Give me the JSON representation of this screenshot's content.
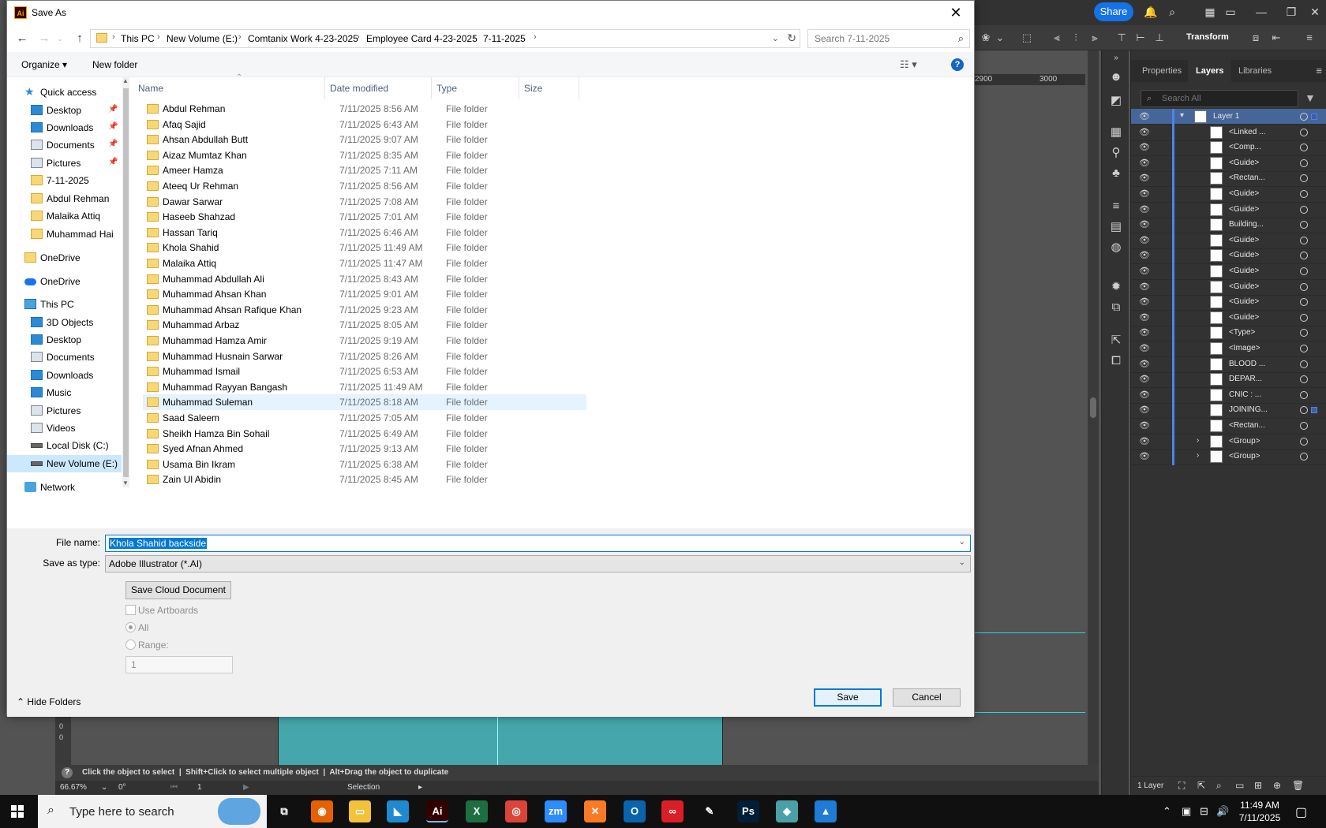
{
  "dialog": {
    "title": "Save As",
    "close_glyph": "✕",
    "breadcrumbs": [
      "This PC",
      "New Volume (E:)",
      "Comtanix Work 4-23-2025",
      "Employee Card 4-23-2025",
      "7-11-2025"
    ],
    "search_placeholder": "Search 7-11-2025",
    "toolbar": {
      "organize": "Organize ▾",
      "new_folder": "New folder",
      "help": "?"
    },
    "nav_pane": [
      {
        "label": "Quick access",
        "icon": "star-icon",
        "pinned": false
      },
      {
        "label": "Desktop",
        "icon": "desktop-icon",
        "pinned": true
      },
      {
        "label": "Downloads",
        "icon": "download-icon",
        "pinned": true
      },
      {
        "label": "Documents",
        "icon": "documents-icon",
        "pinned": true
      },
      {
        "label": "Pictures",
        "icon": "pictures-icon",
        "pinned": true
      },
      {
        "label": "7-11-2025",
        "icon": "folder-icon",
        "pinned": false
      },
      {
        "label": "Abdul Rehman",
        "icon": "folder-icon",
        "pinned": false
      },
      {
        "label": "Malaika Attiq",
        "icon": "folder-icon",
        "pinned": false
      },
      {
        "label": "Muhammad Hai",
        "icon": "folder-icon",
        "pinned": false
      },
      {
        "label": "OneDrive",
        "icon": "folder-icon",
        "pinned": false
      },
      {
        "label": "OneDrive",
        "icon": "cloud-icon",
        "pinned": false
      },
      {
        "label": "This PC",
        "icon": "pc-icon",
        "pinned": false
      },
      {
        "label": "3D Objects",
        "icon": "objects-3d-icon",
        "pinned": false
      },
      {
        "label": "Desktop",
        "icon": "desktop-icon",
        "pinned": false
      },
      {
        "label": "Documents",
        "icon": "documents-icon",
        "pinned": false
      },
      {
        "label": "Downloads",
        "icon": "download-icon",
        "pinned": false
      },
      {
        "label": "Music",
        "icon": "music-icon",
        "pinned": false
      },
      {
        "label": "Pictures",
        "icon": "pictures-icon",
        "pinned": false
      },
      {
        "label": "Videos",
        "icon": "videos-icon",
        "pinned": false
      },
      {
        "label": "Local Disk (C:)",
        "icon": "disk-icon",
        "pinned": false
      },
      {
        "label": "New Volume (E:)",
        "icon": "disk-icon",
        "pinned": false,
        "selected": true
      },
      {
        "label": "Network",
        "icon": "network-icon",
        "pinned": false
      }
    ],
    "columns": [
      "Name",
      "Date modified",
      "Type",
      "Size"
    ],
    "files": [
      {
        "name": "Abdul Rehman",
        "date": "7/11/2025 8:56 AM",
        "type": "File folder"
      },
      {
        "name": "Afaq Sajid",
        "date": "7/11/2025 6:43 AM",
        "type": "File folder"
      },
      {
        "name": "Ahsan Abdullah Butt",
        "date": "7/11/2025 9:07 AM",
        "type": "File folder"
      },
      {
        "name": "Aizaz Mumtaz Khan",
        "date": "7/11/2025 8:35 AM",
        "type": "File folder"
      },
      {
        "name": "Ameer Hamza",
        "date": "7/11/2025 7:11 AM",
        "type": "File folder"
      },
      {
        "name": "Ateeq Ur Rehman",
        "date": "7/11/2025 8:56 AM",
        "type": "File folder"
      },
      {
        "name": "Dawar Sarwar",
        "date": "7/11/2025 7:08 AM",
        "type": "File folder"
      },
      {
        "name": "Haseeb Shahzad",
        "date": "7/11/2025 7:01 AM",
        "type": "File folder"
      },
      {
        "name": "Hassan Tariq",
        "date": "7/11/2025 6:46 AM",
        "type": "File folder"
      },
      {
        "name": "Khola Shahid",
        "date": "7/11/2025 11:49 AM",
        "type": "File folder"
      },
      {
        "name": "Malaika Attiq",
        "date": "7/11/2025 11:47 AM",
        "type": "File folder"
      },
      {
        "name": "Muhammad Abdullah Ali",
        "date": "7/11/2025 8:43 AM",
        "type": "File folder"
      },
      {
        "name": "Muhammad Ahsan Khan",
        "date": "7/11/2025 9:01 AM",
        "type": "File folder"
      },
      {
        "name": "Muhammad Ahsan Rafique Khan",
        "date": "7/11/2025 9:23 AM",
        "type": "File folder"
      },
      {
        "name": "Muhammad Arbaz",
        "date": "7/11/2025 8:05 AM",
        "type": "File folder"
      },
      {
        "name": "Muhammad Hamza Amir",
        "date": "7/11/2025 9:19 AM",
        "type": "File folder"
      },
      {
        "name": "Muhammad Husnain Sarwar",
        "date": "7/11/2025 8:26 AM",
        "type": "File folder"
      },
      {
        "name": "Muhammad Ismail",
        "date": "7/11/2025 6:53 AM",
        "type": "File folder"
      },
      {
        "name": "Muhammad Rayyan Bangash",
        "date": "7/11/2025 11:49 AM",
        "type": "File folder"
      },
      {
        "name": "Muhammad Suleman",
        "date": "7/11/2025 8:18 AM",
        "type": "File folder",
        "hover": true
      },
      {
        "name": "Saad Saleem",
        "date": "7/11/2025 7:05 AM",
        "type": "File folder"
      },
      {
        "name": "Sheikh Hamza Bin Sohail",
        "date": "7/11/2025 6:49 AM",
        "type": "File folder"
      },
      {
        "name": "Syed Afnan Ahmed",
        "date": "7/11/2025 9:13 AM",
        "type": "File folder"
      },
      {
        "name": "Usama Bin Ikram",
        "date": "7/11/2025 6:38 AM",
        "type": "File folder"
      },
      {
        "name": "Zain Ul Abidin",
        "date": "7/11/2025 8:45 AM",
        "type": "File folder"
      }
    ],
    "filename_label": "File name:",
    "filename_value": "Khola Shahid backside",
    "savetype_label": "Save as type:",
    "savetype_value": "Adobe Illustrator (*.AI)",
    "cloud_button": "Save Cloud Document",
    "use_artboards": "Use Artboards",
    "all_label": "All",
    "range_label": "Range:",
    "range_value": "1",
    "hide_folders": "Hide Folders",
    "save_button": "Save",
    "cancel_button": "Cancel"
  },
  "illustrator": {
    "share": "Share",
    "transform": "Transform",
    "ruler_ticks": [
      "2900",
      "3000"
    ],
    "panel_tabs": [
      "Properties",
      "Layers",
      "Libraries"
    ],
    "search_placeholder": "Search All",
    "layers": [
      {
        "name": "Layer 1",
        "top": true
      },
      {
        "name": "<Linked ..."
      },
      {
        "name": "<Comp..."
      },
      {
        "name": "<Guide>"
      },
      {
        "name": "<Rectan..."
      },
      {
        "name": "<Guide>"
      },
      {
        "name": "<Guide>"
      },
      {
        "name": "Building..."
      },
      {
        "name": "<Guide>"
      },
      {
        "name": "<Guide>"
      },
      {
        "name": "<Guide>"
      },
      {
        "name": "<Guide>"
      },
      {
        "name": "<Guide>"
      },
      {
        "name": "<Guide>"
      },
      {
        "name": "<Type>"
      },
      {
        "name": "<Image>"
      },
      {
        "name": "BLOOD ..."
      },
      {
        "name": "DEPAR..."
      },
      {
        "name": "CNIC : ..."
      },
      {
        "name": "JOINING...",
        "selected": true
      },
      {
        "name": "<Rectan..."
      },
      {
        "name": "<Group>",
        "expandable": true
      },
      {
        "name": "<Group>",
        "expandable": true
      }
    ],
    "layers_count": "1 Layer",
    "status_hint": "Click the object to select  |  Shift+Click to select multiple object  |  Alt+Drag the object to duplicate",
    "zoom": "66.67%",
    "rotation": "0°",
    "artboard_num": "1",
    "tool_mode": "Selection",
    "ruler_left": [
      "0",
      "0"
    ]
  },
  "taskbar": {
    "search_text": "Type here to search",
    "apps": [
      {
        "name": "task-view",
        "glyph": "⧉",
        "color": "#101010"
      },
      {
        "name": "firefox",
        "glyph": "◉",
        "color": "#e66000"
      },
      {
        "name": "file-explorer",
        "glyph": "▭",
        "color": "#f3c13a"
      },
      {
        "name": "vscode",
        "glyph": "◣",
        "color": "#1f8ad2"
      },
      {
        "name": "illustrator",
        "glyph": "Ai",
        "color": "#330000",
        "active": true
      },
      {
        "name": "excel",
        "glyph": "X",
        "color": "#1d6f42"
      },
      {
        "name": "chrome",
        "glyph": "◎",
        "color": "#db4437"
      },
      {
        "name": "zoom",
        "glyph": "zm",
        "color": "#2d8cff"
      },
      {
        "name": "xampp",
        "glyph": "✕",
        "color": "#fb7a24"
      },
      {
        "name": "outlook",
        "glyph": "O",
        "color": "#0a64ad"
      },
      {
        "name": "creative-cloud",
        "glyph": "∞",
        "color": "#da1f26"
      },
      {
        "name": "pen-tool",
        "glyph": "✎",
        "color": "#101010"
      },
      {
        "name": "photoshop",
        "glyph": "Ps",
        "color": "#001e36"
      },
      {
        "name": "virtualbox",
        "glyph": "◆",
        "color": "#4aa0a8"
      },
      {
        "name": "photos",
        "glyph": "▲",
        "color": "#1e7bd6"
      }
    ],
    "time": "11:49 AM",
    "date": "7/11/2025"
  }
}
